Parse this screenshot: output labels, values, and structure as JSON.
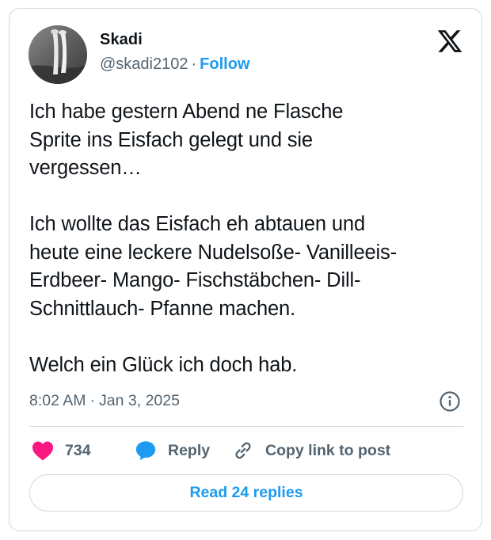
{
  "author": {
    "name": "Skadi",
    "handle": "@skadi2102",
    "separator": "·",
    "follow_label": "Follow"
  },
  "icons": {
    "platform": "x-logo-icon",
    "info": "info-icon",
    "like": "heart-icon",
    "reply": "speech-bubble-icon",
    "copy": "link-icon"
  },
  "post": {
    "text": "Ich habe gestern Abend ne Flasche\nSprite ins Eisfach gelegt und sie\nvergessen…\n\nIch wollte das Eisfach eh abtauen und\nheute eine leckere Nudelsoße- Vanilleeis-\nErdbeer- Mango- Fischstäbchen- Dill-\nSchnittlauch- Pfanne machen.\n\nWelch ein Glück ich doch hab.",
    "time": "8:02 AM",
    "separator": "·",
    "date": "Jan 3, 2025"
  },
  "actions": {
    "like_count": "734",
    "reply_label": "Reply",
    "copy_label": "Copy link to post"
  },
  "replies_button": "Read 24 replies",
  "colors": {
    "accent": "#1d9bf0",
    "like": "#f91880",
    "secondary_text": "#536471",
    "border": "#cfd9de"
  }
}
